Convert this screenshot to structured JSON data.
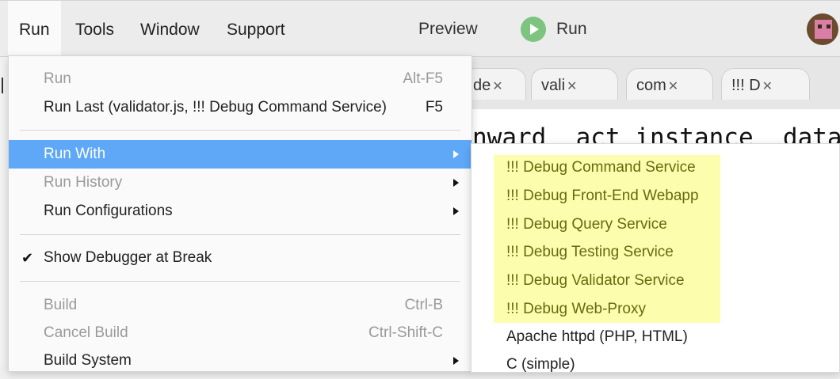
{
  "menubar": {
    "items": [
      {
        "label": "Run"
      },
      {
        "label": "Tools"
      },
      {
        "label": "Window"
      },
      {
        "label": "Support"
      }
    ],
    "preview_label": "Preview",
    "run_label": "Run",
    "run_icon": "play-circle-icon",
    "avatar_icon": "user-avatar-icon"
  },
  "tabs": [
    {
      "label": "de",
      "close": "✕"
    },
    {
      "label": "vali",
      "close": "✕"
    },
    {
      "label": "com",
      "close": "✕"
    },
    {
      "label": "!!! D",
      "close": "✕"
    }
  ],
  "editor": {
    "code_fragment": "nward  act instance  data"
  },
  "run_menu": {
    "run": {
      "label": "Run",
      "accel": "Alt-F5"
    },
    "run_last": {
      "label": "Run Last (validator.js, !!! Debug Command Service)",
      "accel": "F5"
    },
    "run_with": {
      "label": "Run With"
    },
    "run_history": {
      "label": "Run History"
    },
    "run_configurations": {
      "label": "Run Configurations"
    },
    "show_debugger": {
      "label": "Show Debugger at Break",
      "check": "✔"
    },
    "build": {
      "label": "Build",
      "accel": "Ctrl-B"
    },
    "cancel_build": {
      "label": "Cancel Build",
      "accel": "Ctrl-Shift-C"
    },
    "build_system": {
      "label": "Build System"
    }
  },
  "run_with_menu": {
    "items": [
      {
        "label": "!!! Debug Command Service"
      },
      {
        "label": "!!! Debug Front-End Webapp"
      },
      {
        "label": "!!! Debug Query Service"
      },
      {
        "label": "!!! Debug Testing Service"
      },
      {
        "label": "!!! Debug Validator Service"
      },
      {
        "label": "!!! Debug Web-Proxy"
      },
      {
        "label": "Apache httpd (PHP, HTML)"
      },
      {
        "label": "C (simple)"
      }
    ]
  },
  "colors": {
    "highlight": "#5fa8f7",
    "submenu_highlight_bg": "#fdfdae",
    "submenu_highlight_text": "#666b10",
    "run_icon": "#7cc47f"
  }
}
